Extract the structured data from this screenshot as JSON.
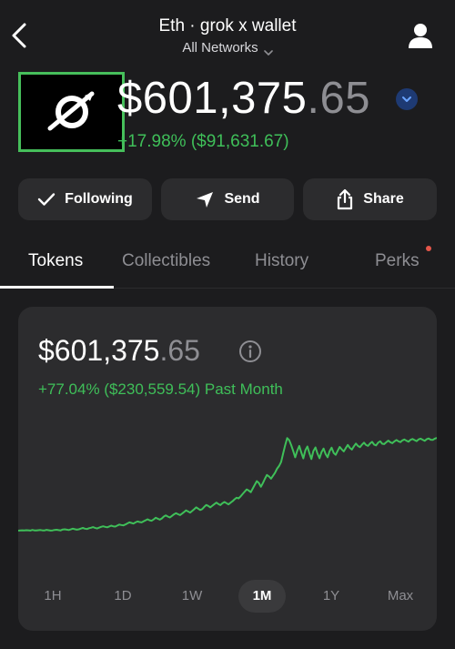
{
  "header": {
    "title": "Eth · grok x wallet",
    "network_label": "All Networks"
  },
  "balance": {
    "whole": "$601,375",
    "cents": ".65",
    "change": "+17.98% ($91,631.67)"
  },
  "actions": [
    {
      "label": "Following",
      "icon": "checkmark-icon"
    },
    {
      "label": "Send",
      "icon": "send-icon"
    },
    {
      "label": "Share",
      "icon": "share-icon"
    }
  ],
  "tabs": [
    {
      "label": "Tokens",
      "active": true
    },
    {
      "label": "Collectibles",
      "active": false
    },
    {
      "label": "History",
      "active": false
    },
    {
      "label": "Perks",
      "active": false,
      "notification_dot": true
    }
  ],
  "card": {
    "balance_whole": "$601,375",
    "balance_cents": ".65",
    "change": "+77.04% ($230,559.54) Past Month"
  },
  "ranges": [
    {
      "label": "1H",
      "active": false
    },
    {
      "label": "1D",
      "active": false
    },
    {
      "label": "1W",
      "active": false
    },
    {
      "label": "1M",
      "active": true
    },
    {
      "label": "1Y",
      "active": false
    },
    {
      "label": "Max",
      "active": false
    }
  ],
  "colors": {
    "background": "#1c1c1e",
    "card": "#2c2c2e",
    "positive": "#3fbf59",
    "muted": "#8e8e93",
    "logo_border": "#46bf5b",
    "network_badge": "#1e3a73",
    "notification": "#e5564a"
  },
  "chart_data": {
    "type": "line",
    "series": [
      {
        "values": [
          370.7,
          371.2,
          371.4,
          371.0,
          371.6,
          371.4,
          370.9,
          372.1,
          371.2,
          371.0,
          371.5,
          372.0,
          371.3,
          371.1,
          372.2,
          371.6,
          370.9,
          371.3,
          372.1,
          372.5,
          371.8,
          371.3,
          372.9,
          373.4,
          372.6,
          372.0,
          373.2,
          374.6,
          373.5,
          372.6,
          373.4,
          374.8,
          376.0,
          374.6,
          373.9,
          375.4,
          376.4,
          377.5,
          376.2,
          375.0,
          376.5,
          378.1,
          379.2,
          378.0,
          377.2,
          378.8,
          380.3,
          379.2,
          378.6,
          380.5,
          382.4,
          381.5,
          380.8,
          382.6,
          384.8,
          386.7,
          385.6,
          384.4,
          386.6,
          388.4,
          387.4,
          386.6,
          388.8,
          390.7,
          392.6,
          390.8,
          389.9,
          392.5,
          395.6,
          393.8,
          391.9,
          394.3,
          397.9,
          400.2,
          398.0,
          396.2,
          399.2,
          402.2,
          404.4,
          402.5,
          400.7,
          403.5,
          406.6,
          409.8,
          407.8,
          405.4,
          408.6,
          412.0,
          415.6,
          413.2,
          410.6,
          412.4,
          416.6,
          420.3,
          418.5,
          415.6,
          418.8,
          422.0,
          424.8,
          422.2,
          420.1,
          423.5,
          426.0,
          423.8,
          421.5,
          424.6,
          427.6,
          431.2,
          434.3,
          433.1,
          436.8,
          441.6,
          446.0,
          450.3,
          448.1,
          445.0,
          452.1,
          459.3,
          466.2,
          462.8,
          455.3,
          462.5,
          470.8,
          478.1,
          475.4,
          470.9,
          476.5,
          482.3,
          490.1,
          495.6,
          503.1,
          519.2,
          535.0,
          549.2,
          545.3,
          535.8,
          524.6,
          512.3,
          525.1,
          534.2,
          521.5,
          510.2,
          526.0,
          533.2,
          520.1,
          508.9,
          524.3,
          531.4,
          519.2,
          510.4,
          522.0,
          529.1,
          518.5,
          512.2,
          524.2,
          530.8,
          520.6,
          516.9,
          524.8,
          532.2,
          527.4,
          523.6,
          530.2,
          536.1,
          530.5,
          527.2,
          533.5,
          538.8,
          534.1,
          531.9,
          536.6,
          540.5,
          536.0,
          534.2,
          538.9,
          542.1,
          536.8,
          535.3,
          540.6,
          543.2,
          538.3,
          537.6,
          541.2,
          544.4,
          541.3,
          539.4,
          542.8,
          545.6,
          543.2,
          541.6,
          544.8,
          546.6,
          544.1,
          542.5,
          545.9,
          547.5,
          545.4,
          543.4,
          546.9,
          548.3,
          546.1,
          544.0,
          547.2,
          548.6,
          546.2,
          545.7,
          548.3,
          549.8
        ]
      }
    ]
  }
}
